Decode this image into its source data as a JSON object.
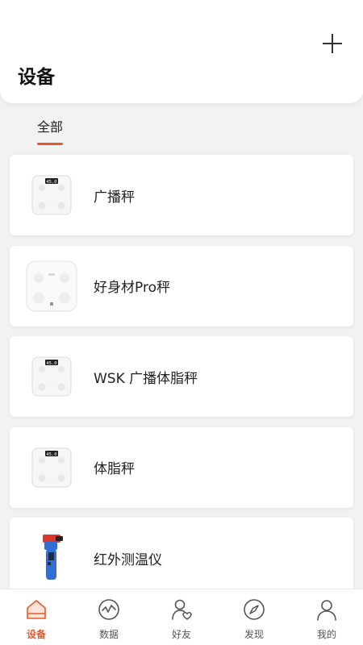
{
  "header": {
    "title": "设备",
    "add_icon": "plus-icon"
  },
  "tabs": [
    {
      "label": "全部",
      "active": true
    }
  ],
  "devices": [
    {
      "name": "广播秤",
      "icon": "scale-icon"
    },
    {
      "name": "好身材Pro秤",
      "icon": "scale-pro-icon"
    },
    {
      "name": "WSK 广播体脂秤",
      "icon": "scale-icon"
    },
    {
      "name": "体脂秤",
      "icon": "scale-icon"
    },
    {
      "name": "红外测温仪",
      "icon": "thermometer-gun-icon"
    }
  ],
  "scale_display": "45.0",
  "nav": [
    {
      "label": "设备",
      "icon": "home-icon",
      "active": true
    },
    {
      "label": "数据",
      "icon": "chart-icon",
      "active": false
    },
    {
      "label": "好友",
      "icon": "friends-icon",
      "active": false
    },
    {
      "label": "发现",
      "icon": "compass-icon",
      "active": false
    },
    {
      "label": "我的",
      "icon": "profile-icon",
      "active": false
    }
  ],
  "colors": {
    "accent": "#e8592a",
    "background": "#f2f2f2",
    "card": "#ffffff"
  }
}
